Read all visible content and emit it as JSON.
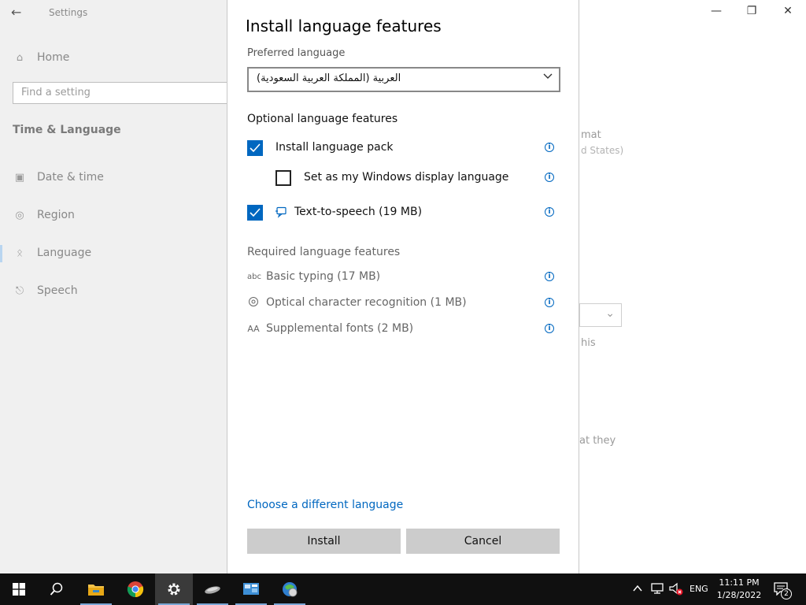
{
  "background_window": {
    "title": "Settings",
    "nav": {
      "home": "Home",
      "search_placeholder": "Find a setting",
      "section": "Time & Language",
      "items": [
        {
          "label": "Date & time"
        },
        {
          "label": "Region"
        },
        {
          "label": "Language"
        },
        {
          "label": "Speech"
        }
      ]
    },
    "partial_text": {
      "t1": "mat",
      "t2": "d States)",
      "t3": "his",
      "t4": "at they"
    }
  },
  "dialog": {
    "title": "Install language features",
    "preferred_label": "Preferred language",
    "preferred_value": "العربية (المملكة العربية السعودية)",
    "optional_heading": "Optional language features",
    "optional": [
      {
        "label": "Install language pack",
        "checked": true
      },
      {
        "label": "Set as my Windows display language",
        "checked": false
      },
      {
        "label": "Text-to-speech (19 MB)",
        "checked": true
      }
    ],
    "required_heading": "Required language features",
    "required": [
      {
        "label": "Basic typing (17 MB)",
        "icon": "abc"
      },
      {
        "label": "Optical character recognition (1 MB)",
        "icon": "ocr-icon"
      },
      {
        "label": "Supplemental fonts (2 MB)",
        "icon": "AA"
      }
    ],
    "link": "Choose a different language",
    "install_button": "Install",
    "cancel_button": "Cancel"
  },
  "taskbar": {
    "apps": [
      "start-icon",
      "search-icon",
      "file-explorer-icon",
      "chrome-icon",
      "settings-icon",
      "app-icon",
      "control-panel-icon",
      "browser-icon"
    ],
    "language": "ENG",
    "time": "11:11 PM",
    "date": "1/28/2022",
    "notification_count": "2"
  },
  "colors": {
    "accent": "#0067c0",
    "button": "#cccccc",
    "taskbar": "#101010"
  }
}
